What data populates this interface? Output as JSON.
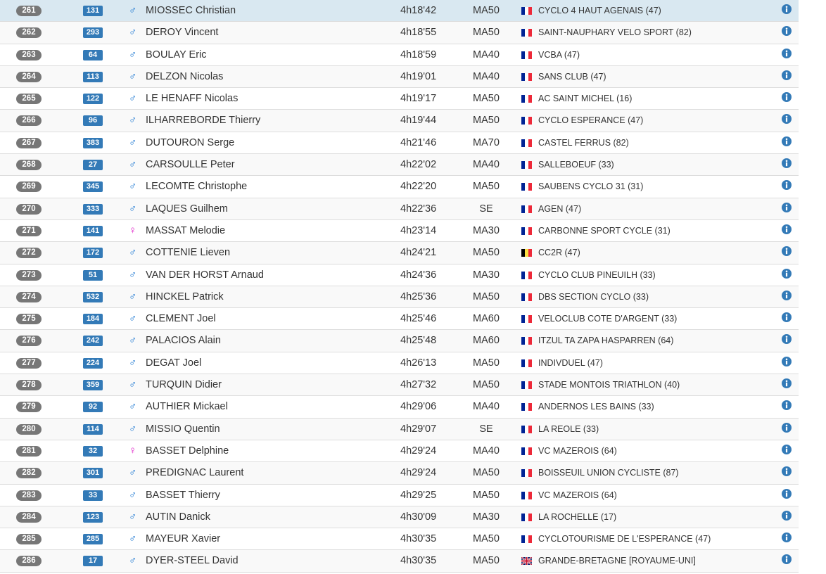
{
  "colors": {
    "rank_badge": "#777777",
    "bib_badge": "#337ab7",
    "male": "#1976d2",
    "female": "#e020c8",
    "info": "#337ab7",
    "highlight_row": "#d9e8f1"
  },
  "rows": [
    {
      "rank": "261",
      "bib": "131",
      "gender": "male",
      "name": "MIOSSEC Christian",
      "time": "4h18'42",
      "category": "MA50",
      "country": "fr",
      "club": "CYCLO 4 HAUT AGENAIS (47)"
    },
    {
      "rank": "262",
      "bib": "293",
      "gender": "male",
      "name": "DEROY Vincent",
      "time": "4h18'55",
      "category": "MA50",
      "country": "fr",
      "club": "SAINT-NAUPHARY VELO SPORT (82)"
    },
    {
      "rank": "263",
      "bib": "64",
      "gender": "male",
      "name": "BOULAY Eric",
      "time": "4h18'59",
      "category": "MA40",
      "country": "fr",
      "club": "VCBA (47)"
    },
    {
      "rank": "264",
      "bib": "113",
      "gender": "male",
      "name": "DELZON Nicolas",
      "time": "4h19'01",
      "category": "MA40",
      "country": "fr",
      "club": "SANS CLUB (47)"
    },
    {
      "rank": "265",
      "bib": "122",
      "gender": "male",
      "name": "LE HENAFF Nicolas",
      "time": "4h19'17",
      "category": "MA50",
      "country": "fr",
      "club": "AC SAINT MICHEL (16)"
    },
    {
      "rank": "266",
      "bib": "96",
      "gender": "male",
      "name": "ILHARREBORDE Thierry",
      "time": "4h19'44",
      "category": "MA50",
      "country": "fr",
      "club": "CYCLO ESPERANCE (47)"
    },
    {
      "rank": "267",
      "bib": "383",
      "gender": "male",
      "name": "DUTOURON Serge",
      "time": "4h21'46",
      "category": "MA70",
      "country": "fr",
      "club": "CASTEL FERRUS (82)"
    },
    {
      "rank": "268",
      "bib": "27",
      "gender": "male",
      "name": "CARSOULLE Peter",
      "time": "4h22'02",
      "category": "MA40",
      "country": "fr",
      "club": "SALLEBOEUF (33)"
    },
    {
      "rank": "269",
      "bib": "345",
      "gender": "male",
      "name": "LECOMTE Christophe",
      "time": "4h22'20",
      "category": "MA50",
      "country": "fr",
      "club": "SAUBENS CYCLO 31 (31)"
    },
    {
      "rank": "270",
      "bib": "333",
      "gender": "male",
      "name": "LAQUES Guilhem",
      "time": "4h22'36",
      "category": "SE",
      "country": "fr",
      "club": "AGEN (47)"
    },
    {
      "rank": "271",
      "bib": "141",
      "gender": "female",
      "name": "MASSAT Melodie",
      "time": "4h23'14",
      "category": "MA30",
      "country": "fr",
      "club": "CARBONNE SPORT CYCLE (31)"
    },
    {
      "rank": "272",
      "bib": "172",
      "gender": "male",
      "name": "COTTENIE Lieven",
      "time": "4h24'21",
      "category": "MA50",
      "country": "be",
      "club": "CC2R (47)"
    },
    {
      "rank": "273",
      "bib": "51",
      "gender": "male",
      "name": "VAN DER HORST Arnaud",
      "time": "4h24'36",
      "category": "MA30",
      "country": "fr",
      "club": "CYCLO CLUB PINEUILH (33)"
    },
    {
      "rank": "274",
      "bib": "532",
      "gender": "male",
      "name": "HINCKEL Patrick",
      "time": "4h25'36",
      "category": "MA50",
      "country": "fr",
      "club": "DBS SECTION CYCLO (33)"
    },
    {
      "rank": "275",
      "bib": "184",
      "gender": "male",
      "name": "CLEMENT Joel",
      "time": "4h25'46",
      "category": "MA60",
      "country": "fr",
      "club": "VELOCLUB COTE D'ARGENT (33)"
    },
    {
      "rank": "276",
      "bib": "242",
      "gender": "male",
      "name": "PALACIOS Alain",
      "time": "4h25'48",
      "category": "MA60",
      "country": "fr",
      "club": "ITZUL TA ZAPA HASPARREN (64)"
    },
    {
      "rank": "277",
      "bib": "224",
      "gender": "male",
      "name": "DEGAT Joel",
      "time": "4h26'13",
      "category": "MA50",
      "country": "fr",
      "club": "INDIVDUEL (47)"
    },
    {
      "rank": "278",
      "bib": "359",
      "gender": "male",
      "name": "TURQUIN Didier",
      "time": "4h27'32",
      "category": "MA50",
      "country": "fr",
      "club": "STADE MONTOIS TRIATHLON (40)"
    },
    {
      "rank": "279",
      "bib": "92",
      "gender": "male",
      "name": "AUTHIER Mickael",
      "time": "4h29'06",
      "category": "MA40",
      "country": "fr",
      "club": "ANDERNOS LES BAINS (33)"
    },
    {
      "rank": "280",
      "bib": "114",
      "gender": "male",
      "name": "MISSIO Quentin",
      "time": "4h29'07",
      "category": "SE",
      "country": "fr",
      "club": "LA REOLE (33)"
    },
    {
      "rank": "281",
      "bib": "32",
      "gender": "female",
      "name": "BASSET Delphine",
      "time": "4h29'24",
      "category": "MA40",
      "country": "fr",
      "club": "VC MAZEROIS (64)"
    },
    {
      "rank": "282",
      "bib": "301",
      "gender": "male",
      "name": "PREDIGNAC Laurent",
      "time": "4h29'24",
      "category": "MA50",
      "country": "fr",
      "club": "BOISSEUIL UNION CYCLISTE (87)"
    },
    {
      "rank": "283",
      "bib": "33",
      "gender": "male",
      "name": "BASSET Thierry",
      "time": "4h29'25",
      "category": "MA50",
      "country": "fr",
      "club": "VC MAZEROIS (64)"
    },
    {
      "rank": "284",
      "bib": "123",
      "gender": "male",
      "name": "AUTIN Danick",
      "time": "4h30'09",
      "category": "MA30",
      "country": "fr",
      "club": "LA ROCHELLE (17)"
    },
    {
      "rank": "285",
      "bib": "285",
      "gender": "male",
      "name": "MAYEUR Xavier",
      "time": "4h30'35",
      "category": "MA50",
      "country": "fr",
      "club": "CYCLOTOURISME DE L'ESPERANCE (47)"
    },
    {
      "rank": "286",
      "bib": "17",
      "gender": "male",
      "name": "DYER-STEEL David",
      "time": "4h30'35",
      "category": "MA50",
      "country": "gb",
      "club": "GRANDE-BRETAGNE [ROYAUME-UNI]"
    }
  ]
}
